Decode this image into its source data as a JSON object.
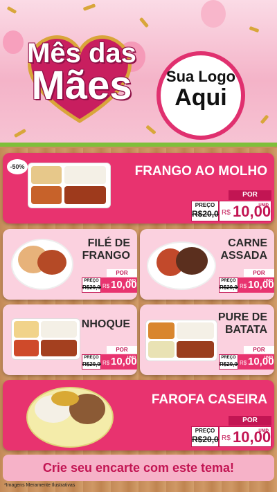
{
  "header": {
    "title_line1": "Mês das",
    "title_line2": "Mães",
    "logo_line1": "Sua Logo",
    "logo_line2": "Aqui"
  },
  "colors": {
    "accent": "#e8336f",
    "accent_dark": "#c21553",
    "light_pink": "#fbd1df"
  },
  "products": [
    {
      "name": "FRANGO AO MOLHO",
      "badge": "-50%",
      "por": "POR",
      "preco_label": "PREÇO",
      "old_price": "R$20,00",
      "currency": "R$",
      "price": "10,00",
      "unit": "UNID"
    },
    {
      "name_line1": "FILÉ DE",
      "name_line2": "FRANGO",
      "por": "POR",
      "preco_label": "PREÇO",
      "old_price": "R$20,00",
      "currency": "R$",
      "price": "10,00",
      "unit": "UNID"
    },
    {
      "name_line1": "CARNE",
      "name_line2": "ASSADA",
      "por": "POR",
      "preco_label": "PREÇO",
      "old_price": "R$20,00",
      "currency": "R$",
      "price": "10,00",
      "unit": "UNID"
    },
    {
      "name": "NHOQUE",
      "por": "POR",
      "preco_label": "PREÇO",
      "old_price": "R$20,00",
      "currency": "R$",
      "price": "10,00",
      "unit": "UNID"
    },
    {
      "name_line1": "PURE DE",
      "name_line2": "BATATA",
      "por": "POR",
      "preco_label": "PREÇO",
      "old_price": "R$20,00",
      "currency": "R$",
      "price": "10,00",
      "unit": "UNID"
    },
    {
      "name": "FAROFA CASEIRA",
      "por": "POR",
      "preco_label": "PREÇO",
      "old_price": "R$20,00",
      "currency": "R$",
      "price": "10,00",
      "unit": "UNID"
    }
  ],
  "cta": "Crie seu encarte com este tema!",
  "disclaimer": "*Imagens Meramente Ilustrativas"
}
